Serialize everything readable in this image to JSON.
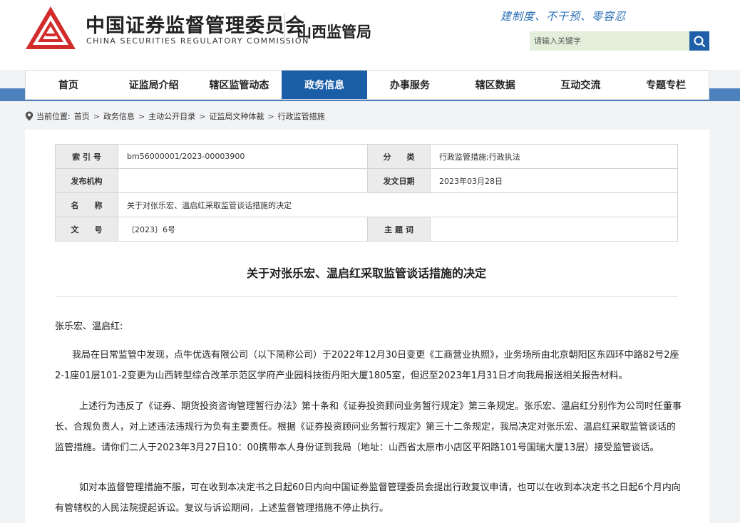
{
  "header": {
    "org_cn": "中国证券监督管理委员会",
    "org_en": "CHINA SECURITIES REGULATORY COMMISSION",
    "branch": "山西监管局",
    "slogan": "建制度、不干预、零容忍",
    "search": {
      "placeholder": "请输入关键字"
    }
  },
  "colors": {
    "brand_red": "#d22b2b",
    "nav_active": "#1a5ea8",
    "band": "#4d81bd",
    "search_bg": "#e3eedb"
  },
  "nav": {
    "items": [
      {
        "label": "首页"
      },
      {
        "label": "证监局介绍"
      },
      {
        "label": "辖区监管动态"
      },
      {
        "label": "政务信息",
        "active": true
      },
      {
        "label": "办事服务"
      },
      {
        "label": "辖区数据"
      },
      {
        "label": "互动交流"
      },
      {
        "label": "专题专栏"
      }
    ]
  },
  "breadcrumb": {
    "prefix": "当前位置:",
    "items": [
      "首页",
      "政务信息",
      "主动公开目录",
      "证监局文种体裁",
      "行政监管措施"
    ],
    "sep": ">"
  },
  "meta": {
    "index_label": "索 引 号",
    "index_value": "bm56000001/2023-00003900",
    "category_label": "分　　类",
    "category_value": "行政监管措施;行政执法",
    "publisher_label": "发布机构",
    "publisher_value": "",
    "date_label": "发文日期",
    "date_value": "2023年03月28日",
    "name_label": "名　　称",
    "name_value": "关于对张乐宏、温启红采取监管谈话措施的决定",
    "docno_label": "文　　号",
    "docno_value": "〔2023〕6号",
    "subject_label": "主 题 词",
    "subject_value": ""
  },
  "document": {
    "title": "关于对张乐宏、温启红采取监管谈话措施的决定",
    "addressee": "张乐宏、温启红:",
    "p1": "我局在日常监管中发现，点牛优选有限公司（以下简称公司）于2022年12月30日变更《工商营业执照》，业务场所由北京朝阳区东四环中路82号2座2-1座01层101-2变更为山西转型综合改革示范区学府产业园科技街丹阳大厦1805室，但迟至2023年1月31日才向我局报送相关报告材料。",
    "p2": "上述行为违反了《证券、期货投资咨询管理暂行办法》第十条和《证券投资顾问业务暂行规定》第三条规定。张乐宏、温启红分别作为公司时任董事长、合规负责人，对上述违法违规行为负有主要责任。根据《证券投资顾问业务暂行规定》第三十二条规定，我局决定对张乐宏、温启红采取监管谈话的监管措施。请你们二人于2023年3月27日10：00携带本人身份证到我局（地址：山西省太原市小店区平阳路101号国瑞大厦13层）接受监管谈话。",
    "p3": "如对本监督管理措施不服，可在收到本决定书之日起60日内向中国证券监督管理委员会提出行政复议申请，也可以在收到本决定书之日起6个月内向有管辖权的人民法院提起诉讼。复议与诉讼期间，上述监督管理措施不停止执行。"
  }
}
